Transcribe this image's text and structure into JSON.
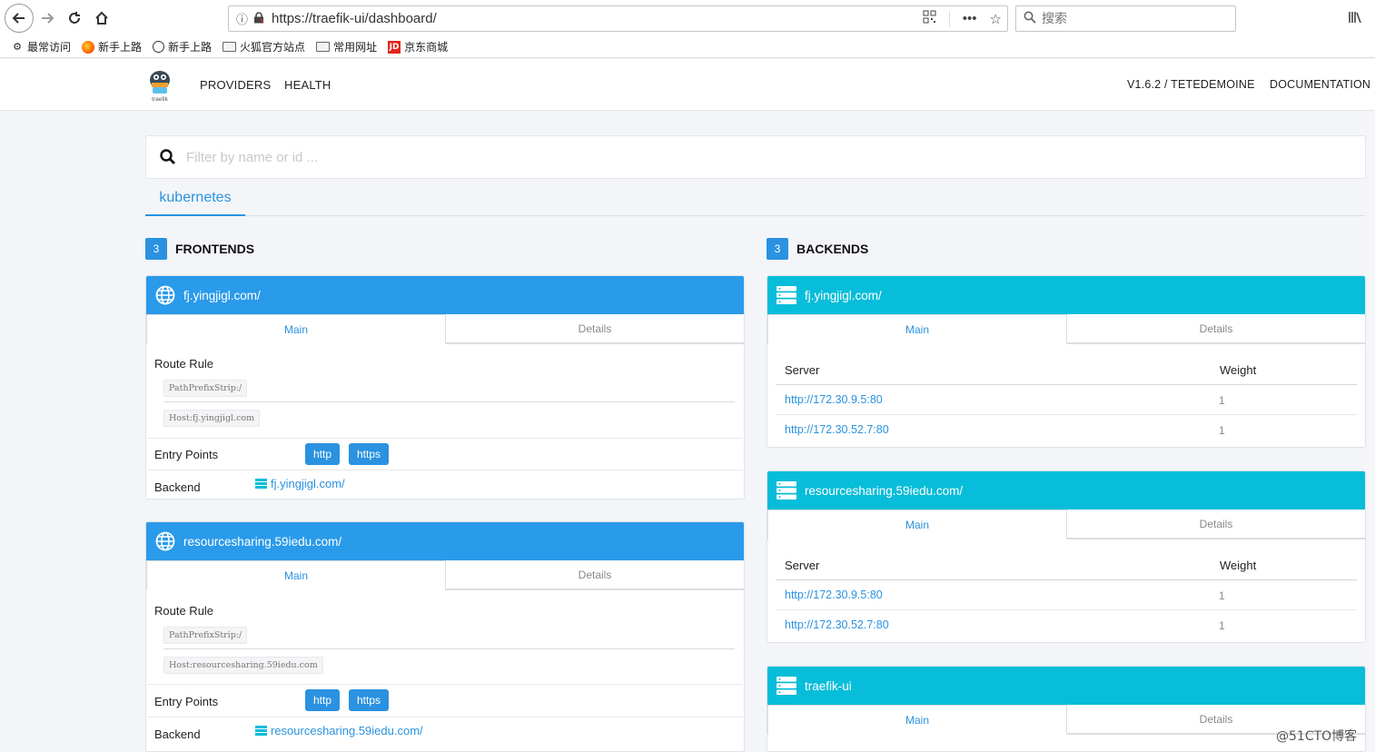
{
  "browser": {
    "url": "https://traefik-ui/dashboard/",
    "search_placeholder": "搜索",
    "bookmarks": [
      {
        "label": "最常访问",
        "icon": "gear-icon"
      },
      {
        "label": "新手上路",
        "icon": "firefox-icon"
      },
      {
        "label": "新手上路",
        "icon": "globe-icon"
      },
      {
        "label": "火狐官方站点",
        "icon": "folder-icon"
      },
      {
        "label": "常用网址",
        "icon": "folder-icon"
      },
      {
        "label": "京东商城",
        "icon": "jd-icon"
      }
    ],
    "jd_mark": "JD"
  },
  "header": {
    "logo_text": "traefik",
    "nav": [
      "PROVIDERS",
      "HEALTH"
    ],
    "version": "V1.6.2 / TETEDEMOINE",
    "docs": "DOCUMENTATION"
  },
  "filter": {
    "placeholder": "Filter by name or id ..."
  },
  "providers": {
    "active": "kubernetes"
  },
  "frontends": {
    "count": "3",
    "title": "FRONTENDS",
    "labels": {
      "route_rule": "Route Rule",
      "entry_points": "Entry Points",
      "backend": "Backend",
      "main": "Main",
      "details": "Details"
    },
    "items": [
      {
        "name": "fj.yingjigl.com/",
        "rules": [
          "PathPrefixStrip:/",
          "Host:fj.yingjigl.com"
        ],
        "entry_points": [
          "http",
          "https"
        ],
        "backend": "fj.yingjigl.com/"
      },
      {
        "name": "resourcesharing.59iedu.com/",
        "rules": [
          "PathPrefixStrip:/",
          "Host:resourcesharing.59iedu.com"
        ],
        "entry_points": [
          "http",
          "https"
        ],
        "backend": "resourcesharing.59iedu.com/"
      }
    ]
  },
  "backends": {
    "count": "3",
    "title": "BACKENDS",
    "labels": {
      "server": "Server",
      "weight": "Weight",
      "main": "Main",
      "details": "Details"
    },
    "items": [
      {
        "name": "fj.yingjigl.com/",
        "servers": [
          {
            "url": "http://172.30.9.5:80",
            "weight": "1"
          },
          {
            "url": "http://172.30.52.7:80",
            "weight": "1"
          }
        ]
      },
      {
        "name": "resourcesharing.59iedu.com/",
        "servers": [
          {
            "url": "http://172.30.9.5:80",
            "weight": "1"
          },
          {
            "url": "http://172.30.52.7:80",
            "weight": "1"
          }
        ]
      },
      {
        "name": "traefik-ui",
        "servers": []
      }
    ]
  },
  "watermark": "@51CTO博客",
  "colors": {
    "frontend": "#2a9aea",
    "backend": "#08bdd9",
    "accent": "#2a92e0"
  }
}
